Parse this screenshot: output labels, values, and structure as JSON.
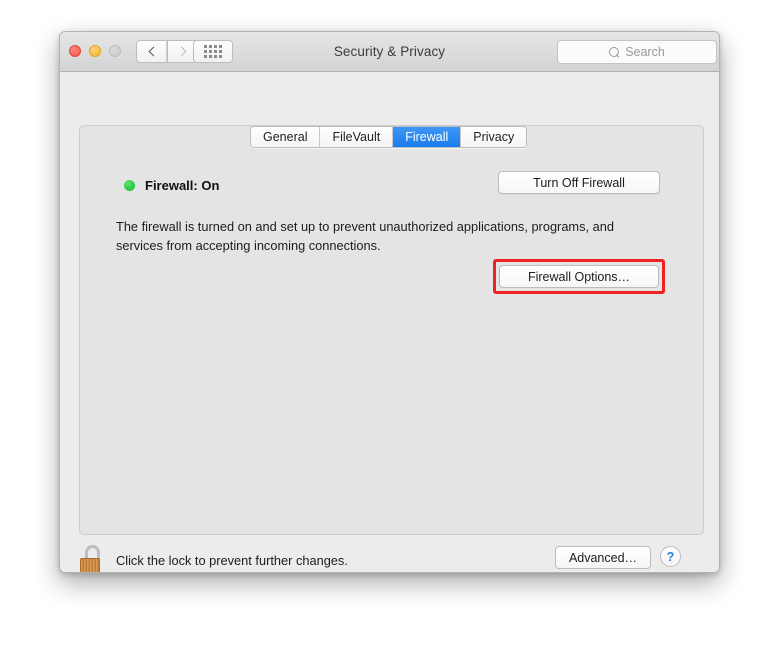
{
  "window": {
    "title": "Security & Privacy",
    "traffic_lights": [
      "close",
      "minimize",
      "zoom"
    ],
    "nav": {
      "back_icon": "chevron-left-icon",
      "forward_icon": "chevron-right-icon"
    },
    "show_all_icon": "grid-dots-icon"
  },
  "search": {
    "placeholder": "Search",
    "value": "",
    "icon": "search-icon"
  },
  "tabs": [
    {
      "label": "General",
      "active": false
    },
    {
      "label": "FileVault",
      "active": false
    },
    {
      "label": "Firewall",
      "active": true
    },
    {
      "label": "Privacy",
      "active": false
    }
  ],
  "firewall": {
    "status_label": "Firewall: On",
    "status_color": "#24c33c",
    "toggle_button": "Turn Off Firewall",
    "description": "The firewall is turned on and set up to prevent unauthorized applications, programs, and services from accepting incoming connections.",
    "options_button": "Firewall Options…",
    "highlight_color": "#ee2222"
  },
  "footer": {
    "lock_icon": "unlocked-padlock-icon",
    "lock_text": "Click the lock to prevent further changes.",
    "advanced_button": "Advanced…",
    "help_button": "?"
  }
}
